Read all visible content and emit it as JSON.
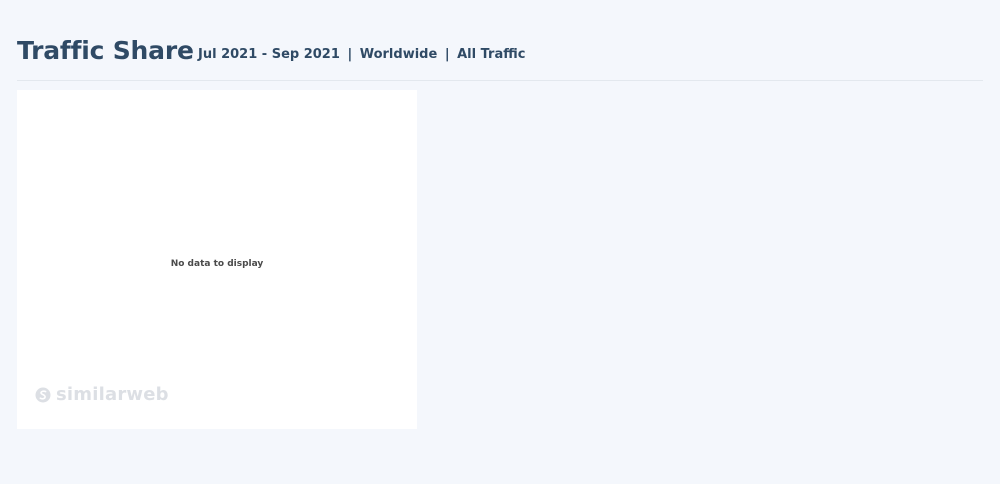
{
  "header": {
    "title": "Traffic Share",
    "subtitle": {
      "date_range": "Jul 2021 - Sep 2021",
      "separator": "|",
      "region": "Worldwide",
      "traffic_type": "All Traffic"
    }
  },
  "widget": {
    "empty_message": "No data to display",
    "watermark": {
      "text": "similarweb",
      "icon": "similarweb-logo-icon"
    }
  },
  "colors": {
    "page_background": "#f4f7fc",
    "card_background": "#ffffff",
    "title_text": "#2f4a65",
    "watermark": "#dcdfe4"
  }
}
